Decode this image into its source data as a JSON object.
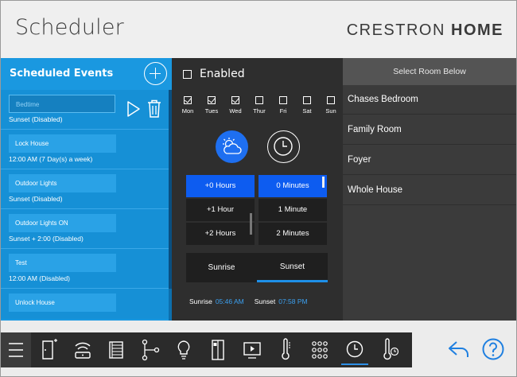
{
  "header": {
    "title": "Scheduler",
    "brand_light": "CRESTRON ",
    "brand_bold": "HOME"
  },
  "events_panel": {
    "title": "Scheduled Events",
    "events": [
      {
        "name": "Bedtime",
        "schedule": "Sunset  (Disabled)",
        "selected": true
      },
      {
        "name": "Lock House",
        "schedule": "12:00 AM (7 Day(s) a week)"
      },
      {
        "name": "Outdoor Lights",
        "schedule": "Sunset  (Disabled)"
      },
      {
        "name": "Outdoor Lights ON",
        "schedule": "Sunset + 2:00 (Disabled)"
      },
      {
        "name": "Test",
        "schedule": "12:00 AM (Disabled)"
      },
      {
        "name": "Unlock House",
        "schedule": ""
      }
    ]
  },
  "detail_panel": {
    "enabled_label": "Enabled",
    "enabled": false,
    "days": [
      {
        "label": "Mon",
        "checked": true
      },
      {
        "label": "Tues",
        "checked": true
      },
      {
        "label": "Wed",
        "checked": true
      },
      {
        "label": "Thur",
        "checked": false
      },
      {
        "label": "Fri",
        "checked": false
      },
      {
        "label": "Sat",
        "checked": false
      },
      {
        "label": "Sun",
        "checked": false
      }
    ],
    "mode_selected": "astronomical",
    "hours_options": [
      "+0 Hours",
      "+1 Hour",
      "+2 Hours"
    ],
    "minutes_options": [
      "0 Minutes",
      "1 Minute",
      "2 Minutes"
    ],
    "hours_selected": "+0 Hours",
    "minutes_selected": "0 Minutes",
    "reference_tabs": [
      "Sunrise",
      "Sunset"
    ],
    "reference_selected": "Sunset",
    "sunrise_label": "Sunrise",
    "sunrise_time": "05:46 AM",
    "sunset_label": "Sunset",
    "sunset_time": "07:58 PM"
  },
  "rooms_panel": {
    "header": "Select Room Below",
    "rooms": [
      "Chases Bedroom",
      "Family Room",
      "Foyer",
      "Whole House"
    ]
  },
  "nav": {
    "items": [
      "menu",
      "room",
      "wifi",
      "shades",
      "scenes",
      "lights",
      "doors",
      "media",
      "climate",
      "more",
      "scheduler",
      "temperature"
    ],
    "active": "scheduler"
  },
  "colors": {
    "events_blue": "#1a98e0",
    "accent_blue": "#0d5cf0",
    "panel_dark": "#2e2e2e",
    "rooms_dark": "#3b3b3b",
    "time_blue": "#3ba0f0"
  }
}
